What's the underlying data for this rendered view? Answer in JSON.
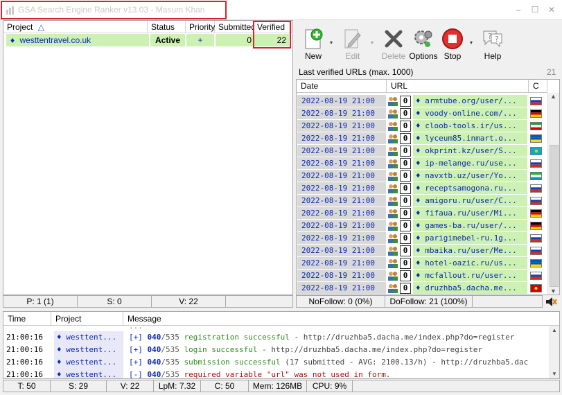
{
  "window": {
    "title": "GSA Search Engine Ranker v13.03 - Masum Khan",
    "min": "–",
    "max": "☐",
    "close": "✕"
  },
  "projects": {
    "columns": {
      "project": "Project",
      "sort_indicator": "△",
      "status": "Status",
      "priority": "Priority",
      "submitted": "Submitted",
      "verified": "Verified"
    },
    "rows": [
      {
        "bullet": "♦",
        "name": "westtentravel.co.uk",
        "status": "Active",
        "priority": "+",
        "submitted": "0",
        "verified": "22"
      }
    ],
    "status": {
      "p": "P: 1 (1)",
      "s": "S: 0",
      "v": "V: 22"
    }
  },
  "toolbar": {
    "new": "New",
    "edit": "Edit",
    "delete": "Delete",
    "options": "Options",
    "stop": "Stop",
    "help": "Help",
    "dropdown": "▾"
  },
  "verified_urls": {
    "label": "Last verified URLs (max. 1000)",
    "count": "21",
    "columns": {
      "date": "Date",
      "url": "URL",
      "country": "C"
    },
    "rows": [
      {
        "date": "2022-08-19 21:00",
        "n": "0",
        "url": "♦ armtube.org/user/...",
        "flag": "ru"
      },
      {
        "date": "2022-08-19 21:00",
        "n": "0",
        "url": "♦ voody-online.com/...",
        "flag": "de"
      },
      {
        "date": "2022-08-19 21:00",
        "n": "0",
        "url": "♦ cloob-tools.ir/us...",
        "flag": "ir"
      },
      {
        "date": "2022-08-19 21:00",
        "n": "0",
        "url": "♦ lyceum85.inmart.o...",
        "flag": "ua"
      },
      {
        "date": "2022-08-19 21:00",
        "n": "0",
        "url": "♦ okprint.kz/user/S...",
        "flag": "kz"
      },
      {
        "date": "2022-08-19 21:00",
        "n": "0",
        "url": "♦ ip-melange.ru/use...",
        "flag": "ru"
      },
      {
        "date": "2022-08-19 21:00",
        "n": "0",
        "url": "♦ navxtb.uz/user/Yo...",
        "flag": "uz"
      },
      {
        "date": "2022-08-19 21:00",
        "n": "0",
        "url": "♦ receptsamogona.ru...",
        "flag": "ru"
      },
      {
        "date": "2022-08-19 21:00",
        "n": "0",
        "url": "♦ amigoru.ru/user/C...",
        "flag": "ru"
      },
      {
        "date": "2022-08-19 21:00",
        "n": "0",
        "url": "♦ fifaua.ru/user/Mi...",
        "flag": "de"
      },
      {
        "date": "2022-08-19 21:00",
        "n": "0",
        "url": "♦ games-ba.ru/user/...",
        "flag": "de"
      },
      {
        "date": "2022-08-19 21:00",
        "n": "0",
        "url": "♦ parigimebel-ru.1g...",
        "flag": "ru"
      },
      {
        "date": "2022-08-19 21:00",
        "n": "0",
        "url": "♦ mbaika.ru/user/Me...",
        "flag": "ru"
      },
      {
        "date": "2022-08-19 21:00",
        "n": "0",
        "url": "♦ hotel-oazic.ru/us...",
        "flag": "ua"
      },
      {
        "date": "2022-08-19 21:00",
        "n": "0",
        "url": "♦ mcfallout.ru/user...",
        "flag": "ru"
      },
      {
        "date": "2022-08-19 21:00",
        "n": "0",
        "url": "♦ druzhba5.dacha.me...",
        "flag": "mk"
      }
    ],
    "status": {
      "nofollow": "NoFollow: 0 (0%)",
      "dofollow": "DoFollow: 21 (100%)"
    }
  },
  "log": {
    "columns": {
      "time": "Time",
      "project": "Project",
      "message": "Message"
    },
    "rows": [
      {
        "time": "",
        "project": "",
        "tag": "",
        "num": "",
        "den": "",
        "msg": "...",
        "url": "",
        "color": "#888888"
      },
      {
        "time": "21:00:16",
        "project": "♦ westtent...",
        "tag": "[+]",
        "num": "040",
        "den": "/535",
        "msg": "registration successful",
        "url": " - http://druzhba5.dacha.me/index.php?do=register",
        "color": "#2e8b1e"
      },
      {
        "time": "21:00:16",
        "project": "♦ westtent...",
        "tag": "[+]",
        "num": "040",
        "den": "/535",
        "msg": "login successful",
        "url": " - http://druzhba5.dacha.me/index.php?do=register",
        "color": "#2e8b1e"
      },
      {
        "time": "21:00:16",
        "project": "♦ westtent...",
        "tag": "[+]",
        "num": "040",
        "den": "/535",
        "msg": "submission successful",
        "url": " (17 submitted - AVG: 2100.13/h) - http://druzhba5.dac",
        "color": "#2e8b1e"
      },
      {
        "time": "21:00:16",
        "project": "♦ westtent...",
        "tag": "[-]",
        "num": "040",
        "den": "/535",
        "msg": "required variable \"url\" was not used in form.",
        "url": "",
        "color": "#b01010"
      }
    ]
  },
  "bottom_status": {
    "t": "T: 50",
    "s": "S: 29",
    "v": "V: 22",
    "lpm": "LpM: 7.32",
    "c": "C: 50",
    "mem": "Mem: 126MB",
    "cpu": "CPU: 9%"
  }
}
